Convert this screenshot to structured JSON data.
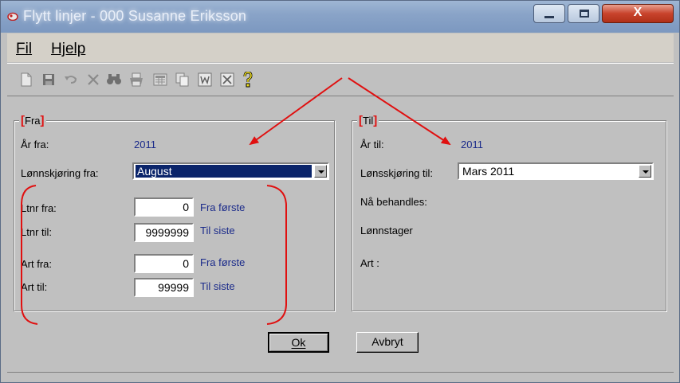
{
  "window": {
    "title": "Flytt linjer - 000 Susanne Eriksson",
    "close_glyph": "X"
  },
  "menu": {
    "fil": "Fil",
    "hjelp": "Hjelp"
  },
  "toolbar_icons": [
    "new-document-icon",
    "save-icon",
    "undo-icon",
    "delete-icon",
    "find-icon",
    "print-icon",
    "calculator-icon",
    "copy-icon",
    "word-icon",
    "excel-icon",
    "help-icon"
  ],
  "fra": {
    "legend": "Fra",
    "ar_label": "År fra:",
    "ar_value": "2011",
    "lonn_label": "Lønnskjøring fra:",
    "lonn_value": "August",
    "ltnr_fra_label": "Ltnr fra:",
    "ltnr_fra_value": "0",
    "ltnr_fra_hint": "Fra første",
    "ltnr_til_label": "Ltnr til:",
    "ltnr_til_value": "9999999",
    "ltnr_til_hint": "Til siste",
    "art_fra_label": "Art fra:",
    "art_fra_value": "0",
    "art_fra_hint": "Fra første",
    "art_til_label": "Art til:",
    "art_til_value": "99999",
    "art_til_hint": "Til siste"
  },
  "til": {
    "legend": "Til",
    "ar_label": "År til:",
    "ar_value": "2011",
    "lonn_label": "Lønsskjøring til:",
    "lonn_value": "Mars 2011",
    "behandles_label": "Nå behandles:",
    "lonnstager_label": "Lønnstager",
    "art_label": "Art :"
  },
  "buttons": {
    "ok": "Ok",
    "avbryt": "Avbryt"
  },
  "colors": {
    "annotation_red": "#e01010",
    "value_blue": "#1a2a8a",
    "selection_blue": "#0a246a"
  }
}
